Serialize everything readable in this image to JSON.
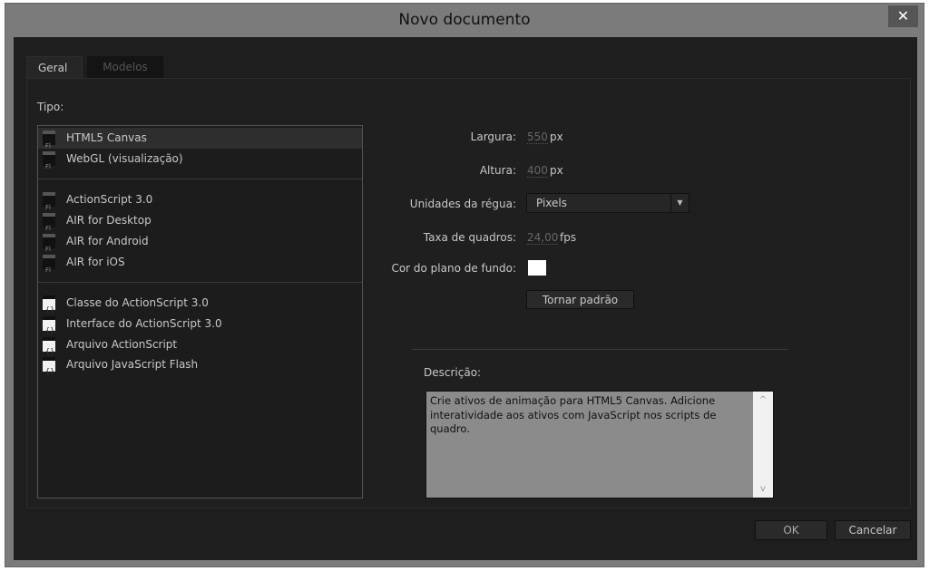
{
  "window": {
    "title": "Novo documento",
    "close": "✕"
  },
  "tabs": [
    {
      "label": "Geral",
      "active": true
    },
    {
      "label": "Modelos",
      "active": false
    }
  ],
  "type_label": "Tipo:",
  "types": [
    {
      "label": "HTML5 Canvas",
      "icon": "fla-file-icon",
      "selected": true
    },
    {
      "label": "WebGL (visualização)",
      "icon": "fla-file-icon"
    },
    {
      "label": "ActionScript 3.0",
      "icon": "fla-file-icon"
    },
    {
      "label": "AIR for Desktop",
      "icon": "fla-file-icon"
    },
    {
      "label": "AIR for Android",
      "icon": "fla-file-icon"
    },
    {
      "label": "AIR for iOS",
      "icon": "fla-file-icon"
    },
    {
      "label": "Classe do ActionScript 3.0",
      "icon": "as-file-icon"
    },
    {
      "label": "Interface do ActionScript 3.0",
      "icon": "as-file-icon"
    },
    {
      "label": "Arquivo ActionScript",
      "icon": "as-file-icon"
    },
    {
      "label": "Arquivo JavaScript Flash",
      "icon": "jsfl-file-icon"
    }
  ],
  "form": {
    "width_label": "Largura:",
    "width": "550",
    "width_unit": "px",
    "height_label": "Altura:",
    "height": "400",
    "height_unit": "px",
    "ruler_label": "Unidades da régua:",
    "ruler": "Pixels",
    "fps_label": "Taxa de quadros:",
    "fps": "24,00",
    "fps_unit": "fps",
    "bg_label": "Cor do plano de fundo:",
    "bg_color": "#ffffff",
    "default_button": "Tornar padrão"
  },
  "description": {
    "label": "Descrição:",
    "text": "Crie ativos de animação para HTML5 Canvas. Adicione interatividade aos ativos com JavaScript nos scripts de quadro.",
    "scroll_up": "^",
    "scroll_down": "v"
  },
  "buttons": {
    "ok": "OK",
    "cancel": "Cancelar"
  }
}
